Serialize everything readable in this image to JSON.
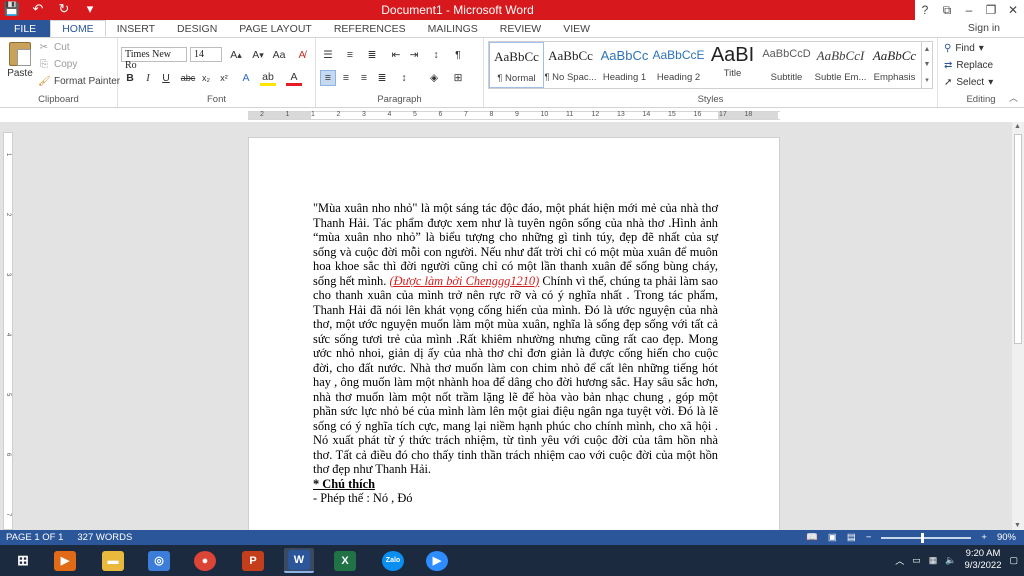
{
  "titlebar": {
    "title": "Document1 - Microsoft Word",
    "help": "?",
    "ribbon_opts": "⧉",
    "minimize": "–",
    "restore": "❐",
    "close": "✕"
  },
  "qat": {
    "save": "💾",
    "undo": "↶",
    "redo": "↻",
    "customize": "▾"
  },
  "tabs": [
    "FILE",
    "HOME",
    "INSERT",
    "DESIGN",
    "PAGE LAYOUT",
    "REFERENCES",
    "MAILINGS",
    "REVIEW",
    "VIEW"
  ],
  "signin": "Sign in",
  "clipboard": {
    "paste": "Paste",
    "cut": "Cut",
    "copy": "Copy",
    "format_painter": "Format Painter",
    "label": "Clipboard"
  },
  "font": {
    "name": "Times New Ro",
    "size": "14",
    "label": "Font"
  },
  "paragraph": {
    "label": "Paragraph"
  },
  "styles": {
    "label": "Styles",
    "items": [
      {
        "preview": "AaBbCc",
        "name": "¶ Normal"
      },
      {
        "preview": "AaBbCc",
        "name": "¶ No Spac..."
      },
      {
        "preview": "AaBbCc",
        "name": "Heading 1"
      },
      {
        "preview": "AaBbCcE",
        "name": "Heading 2"
      },
      {
        "preview": "AaBI",
        "name": "Title"
      },
      {
        "preview": "AaBbCcD",
        "name": "Subtitle"
      },
      {
        "preview": "AaBbCcI",
        "name": "Subtle Em..."
      },
      {
        "preview": "AaBbCc",
        "name": "Emphasis"
      }
    ]
  },
  "editing": {
    "find": "Find",
    "replace": "Replace",
    "select": "Select",
    "label": "Editing"
  },
  "ruler": {
    "numbers": [
      "2",
      "1",
      "1",
      "2",
      "3",
      "4",
      "5",
      "6",
      "7",
      "8",
      "9",
      "10",
      "11",
      "12",
      "13",
      "14",
      "15",
      "16",
      "17",
      "18"
    ]
  },
  "document": {
    "para_before": "\"Mùa xuân nho nhỏ\" là một sáng tác độc đáo, một phát hiện mới mẻ của nhà thơ Thanh Hải. Tác phẩm được xem như là tuyên ngôn sống của nhà thơ .Hình ảnh “mùa xuân nho nhỏ” là biểu tượng cho những gì tinh túy, đẹp đẽ nhất của sự sống và cuộc đời mỗi con người. Nếu như đất trời chỉ có một mùa xuân để muôn hoa khoe sắc thì đời người cũng chỉ có một lần thanh xuân để sống bùng cháy, sống hết mình. ",
    "credit": "(Được làm bởi Chenggg1210)",
    "para_after": " Chính vì thế, chúng ta phải làm sao cho thanh xuân của mình trở nên rực rỡ và có ý nghĩa nhất . Trong tác phẩm, Thanh Hải đã nói lên khát vọng cống hiến của mình. Đó là ước nguyện của nhà thơ, một ước nguyện muốn làm một mùa xuân, nghĩa là sống đẹp sống với tất cả sức sống tươi trẻ của mình .Rất khiêm nhường nhưng cũng rất cao đẹp. Mong ước nhỏ nhoi, giản dị ấy của nhà thơ chỉ đơn giản là được cống hiến cho cuộc đời, cho đất nước. Nhà thơ muốn làm con chim nhỏ để cất lên những tiếng hót hay , ông muốn làm một nhành hoa để dâng cho đời hương sắc. Hay sâu sắc hơn, nhà thơ muốn làm một nốt trầm lặng lẽ để hòa vào bản nhạc chung , góp một phần sức lực nhỏ bé của mình làm lên một giai điệu ngân nga tuyệt vời. Đó là lẽ sống có ý nghĩa tích cực, mang lại niềm hạnh phúc cho chính mình, cho xã hội . Nó xuất phát từ ý thức trách nhiệm, từ tình yêu với cuộc đời của tâm hồn nhà thơ. Tất cả điều đó cho thấy tinh thần trách nhiệm cao với cuộc đời của một hồn thơ đẹp như Thanh Hải.",
    "note_title": "* Chú thích",
    "note_line": "- Phép thế : Nó , Đó"
  },
  "status": {
    "page": "PAGE 1 OF 1",
    "words": "327 WORDS",
    "zoom": "90%"
  },
  "taskbar": {
    "time": "9:20 AM",
    "date": "9/3/2022"
  },
  "colors": {
    "word_blue": "#2b579a",
    "title_red": "#d7191d",
    "credit_red": "#d21f1f"
  }
}
